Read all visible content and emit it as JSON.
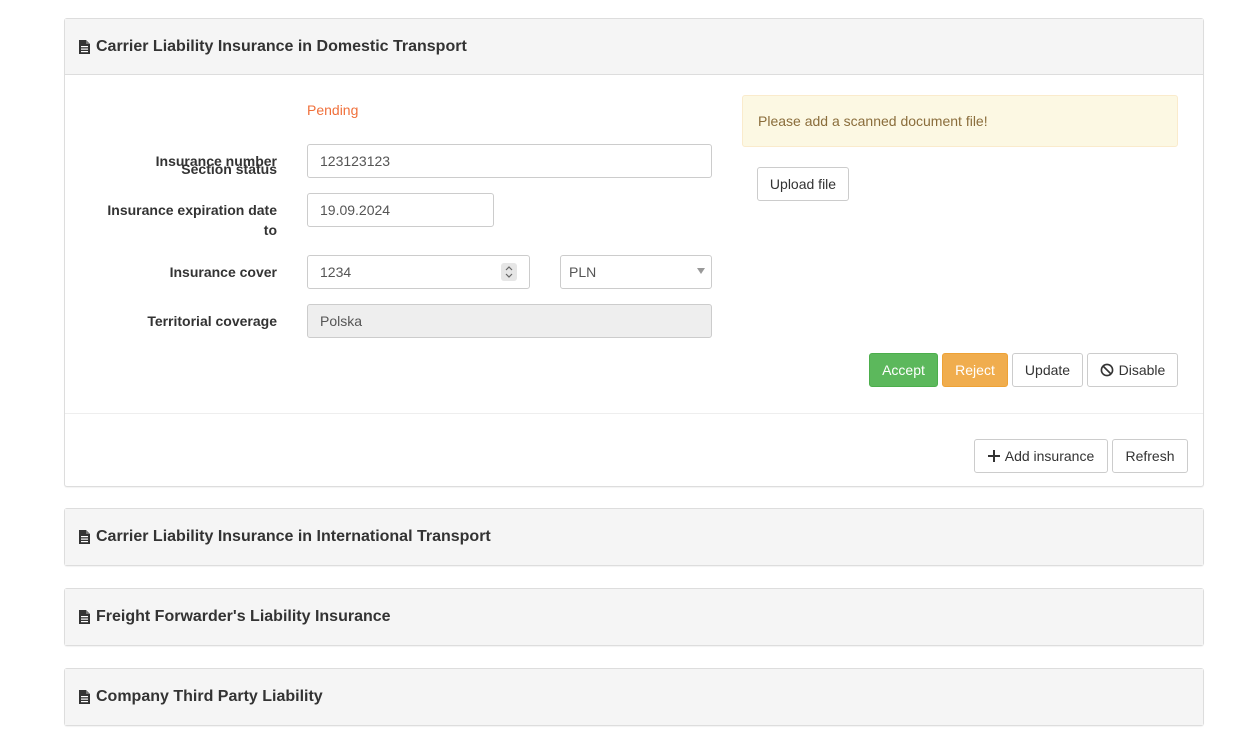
{
  "panels": [
    {
      "title": "Carrier Liability Insurance in Domestic Transport",
      "icon": "document-icon"
    },
    {
      "title": "Carrier Liability Insurance in International Transport",
      "icon": "document-icon"
    },
    {
      "title": "Freight Forwarder's Liability Insurance",
      "icon": "document-icon"
    },
    {
      "title": "Company Third Party Liability",
      "icon": "document-icon"
    }
  ],
  "form": {
    "section_status_label": "Section status",
    "section_status_value": "Pending",
    "insurance_number_label": "Insurance number",
    "insurance_number_value": "123123123",
    "expiration_label_line1": "Insurance expiration date",
    "expiration_label_line2": "to",
    "expiration_value": "19.09.2024",
    "cover_label": "Insurance cover",
    "cover_value": "1234",
    "currency_value": "PLN",
    "territorial_label": "Territorial coverage",
    "territorial_value": "Polska"
  },
  "alert": {
    "message": "Please add a scanned document file!"
  },
  "buttons": {
    "upload": "Upload file",
    "accept": "Accept",
    "reject": "Reject",
    "update": "Update",
    "disable": "Disable",
    "add_insurance": "Add insurance",
    "refresh": "Refresh"
  },
  "colors": {
    "status_pending": "#f0703b",
    "accept": "#5cb85c",
    "reject": "#f0ad4e",
    "alert_bg": "#fcf8e3",
    "alert_text": "#8a6d3b"
  }
}
